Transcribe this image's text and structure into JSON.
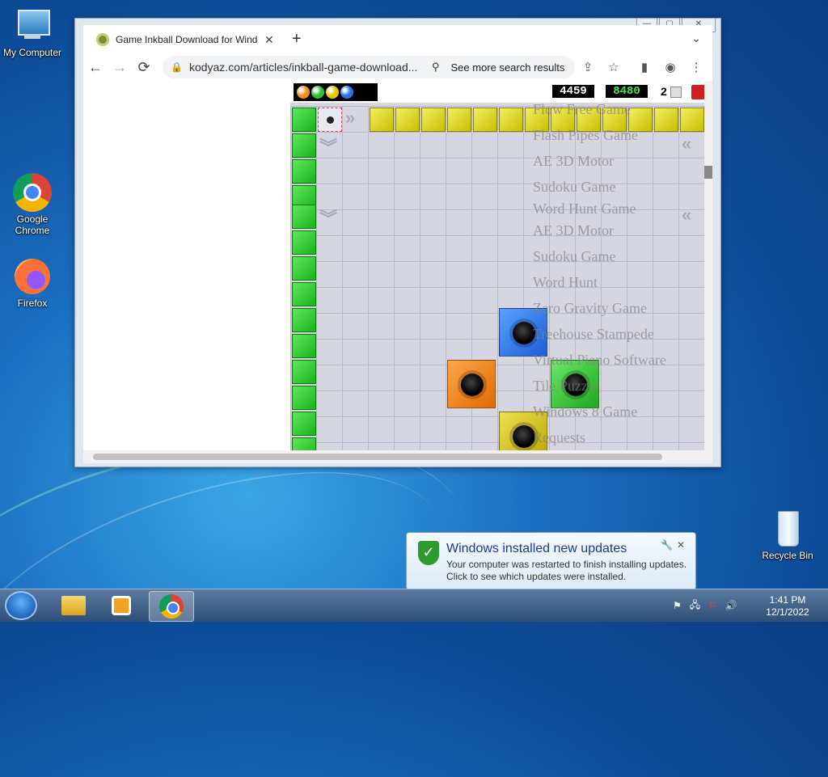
{
  "desktop": {
    "icons": [
      {
        "label": "My Computer"
      },
      {
        "label": "Google Chrome"
      },
      {
        "label": "Firefox"
      },
      {
        "label": "Recycle Bin"
      }
    ]
  },
  "browser": {
    "tab_title": "Game Inkball Download for Windows",
    "tab_close": "✕",
    "new_tab": "+",
    "tab_menu": "⌄",
    "back": "←",
    "forward": "→",
    "reload": "⟳",
    "url": "kodyaz.com/articles/inkball-game-download...",
    "search_results_label": "See more search results",
    "window_controls": [
      "—",
      "▢",
      "✕"
    ]
  },
  "game": {
    "score_white": "4459",
    "score_green": "8480",
    "level": "2",
    "ball_colors": [
      "#f28c1e",
      "#2ebd2e",
      "#e6c800",
      "#2c74e0"
    ],
    "overlay_links": [
      "Flow Free Game",
      "Flash Pipes Game",
      "AE 3D Motor",
      "Sudoku Game",
      "Word Hunt Game",
      "AE 3D Motor",
      "Sudoku Game",
      "Word Hunt",
      "Zero Gravity Game",
      "Treehouse Stampede",
      "Virtual Piano Software",
      "Tile Puzzle",
      "Windows 8 Game",
      "Requests"
    ]
  },
  "notification": {
    "title": "Windows installed new updates",
    "line1": "Your computer was restarted to finish installing updates.",
    "line2": "Click to see which updates were installed.",
    "close": "✕",
    "options": "🔧"
  },
  "taskbar": {
    "time": "1:41 PM",
    "date": "12/1/2022"
  }
}
